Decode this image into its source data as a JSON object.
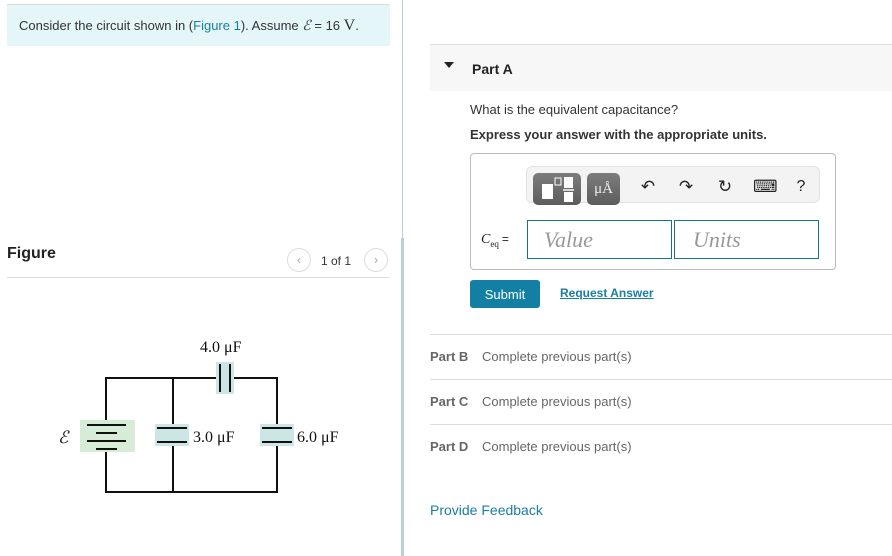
{
  "intro": {
    "text_before": "Consider the circuit shown in (",
    "figure_link": "Figure 1",
    "text_after": "). Assume ",
    "emf_symbol": "ℰ",
    "equals": " = 16 ",
    "unit": "V",
    "period": "."
  },
  "figure": {
    "title": "Figure",
    "counter": "1 of 1",
    "prev_icon": "‹",
    "next_icon": "›",
    "circuit": {
      "emf_label": "ℰ",
      "capacitors": [
        {
          "label": "4.0 μF",
          "position": "top"
        },
        {
          "label": "3.0 μF",
          "position": "middle"
        },
        {
          "label": "6.0 μF",
          "position": "right"
        }
      ]
    }
  },
  "part_a": {
    "title": "Part A",
    "question": "What is the equivalent capacitance?",
    "instructions": "Express your answer with the appropriate units.",
    "toolbar": {
      "units_button": "μÅ",
      "undo_icon": "↶",
      "redo_icon": "↷",
      "reset_icon": "↻",
      "keyboard_icon": "⌨",
      "help_icon": "?"
    },
    "answer_label": "C",
    "answer_sub": "eq",
    "answer_equals": "=",
    "value_placeholder": "Value",
    "units_placeholder": "Units",
    "submit_label": "Submit",
    "request_label": "Request Answer"
  },
  "parts": [
    {
      "label": "Part B",
      "status": "Complete previous part(s)"
    },
    {
      "label": "Part C",
      "status": "Complete previous part(s)"
    },
    {
      "label": "Part D",
      "status": "Complete previous part(s)"
    }
  ],
  "feedback_label": "Provide Feedback",
  "colors": {
    "accent": "#137fa3",
    "link": "#1a7ea3",
    "intro_bg": "#e4f6f7",
    "capacitor_fill": "#cce6e6",
    "battery_fill": "#d6ecd6"
  }
}
